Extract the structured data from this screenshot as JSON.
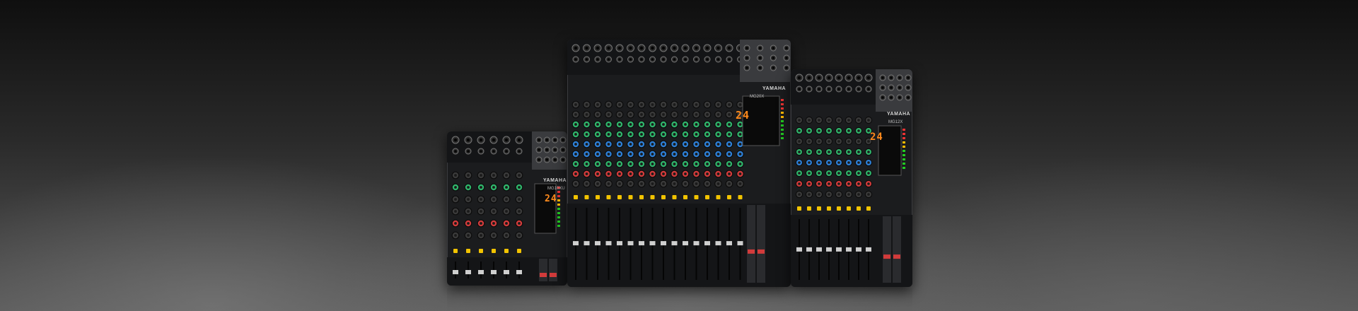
{
  "scene": {
    "colors": {
      "panel": "#1b1c1e",
      "knob_green": "#2fb36a",
      "knob_blue": "#2d7fd6",
      "knob_red": "#d23b3b",
      "knob_black": "#3a3a3a",
      "button_yellow": "#f2c300",
      "led_orange": "#ff8a1c"
    },
    "mixers": [
      {
        "brand": "YAMAHA",
        "model": "MG10XU",
        "display": "24"
      },
      {
        "brand": "YAMAHA",
        "model": "MG20X",
        "display": "24"
      },
      {
        "brand": "YAMAHA",
        "model": "MG12X",
        "display": "24"
      }
    ]
  }
}
